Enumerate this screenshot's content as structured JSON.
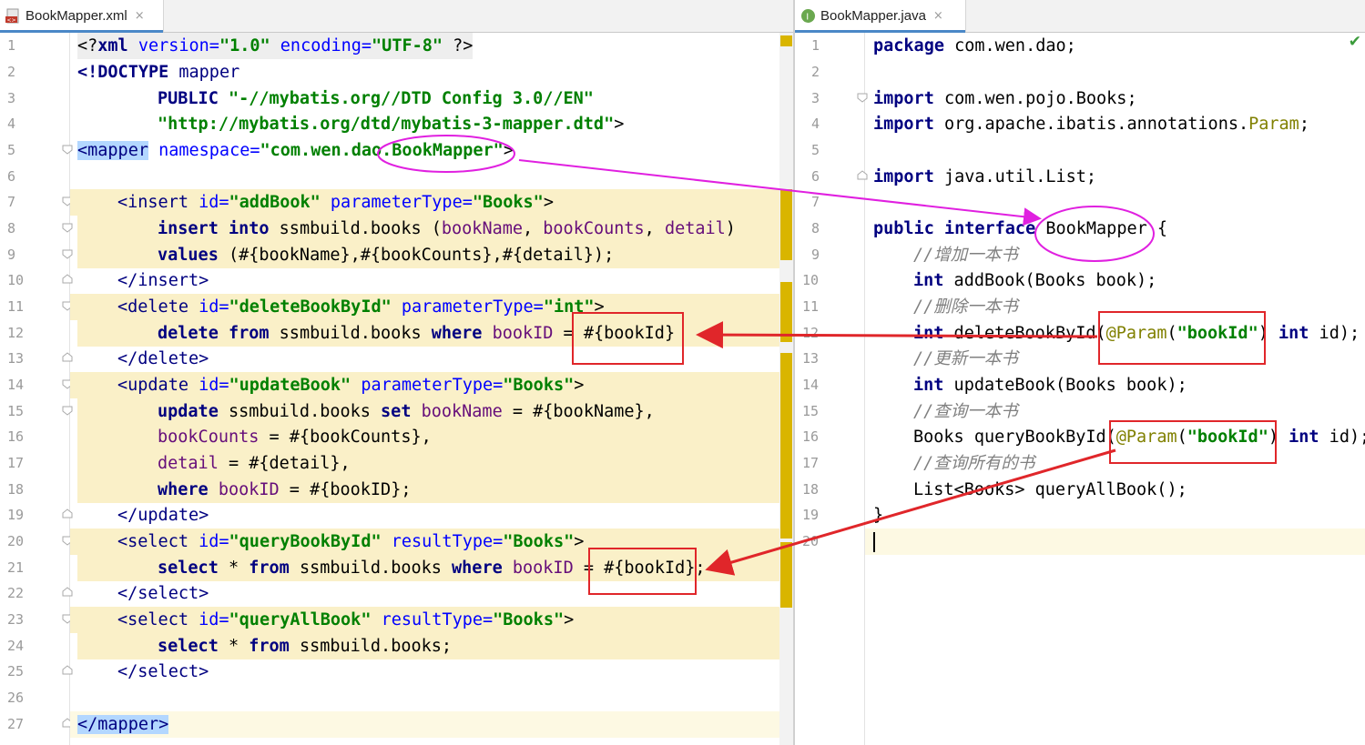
{
  "left_tab": {
    "name": "BookMapper.xml",
    "close": "×",
    "icon": "xml-file-icon"
  },
  "right_tab": {
    "name": "BookMapper.java",
    "close": "×",
    "icon": "java-interface-icon",
    "icon_letter": "I"
  },
  "left_lines": [
    "1",
    "2",
    "3",
    "4",
    "5",
    "6",
    "7",
    "8",
    "9",
    "10",
    "11",
    "12",
    "13",
    "14",
    "15",
    "16",
    "17",
    "18",
    "19",
    "20",
    "21",
    "22",
    "23",
    "24",
    "25",
    "26",
    "27"
  ],
  "right_lines": [
    "1",
    "2",
    "3",
    "4",
    "5",
    "6",
    "7",
    "8",
    "9",
    "10",
    "11",
    "12",
    "13",
    "14",
    "15",
    "16",
    "17",
    "18",
    "19",
    "20"
  ],
  "xml": {
    "l1_open": "<?",
    "l1_xml": "xml",
    "l1_version_attr": " version=",
    "l1_version_val": "\"1.0\"",
    "l1_enc_attr": " encoding=",
    "l1_enc_val": "\"UTF-8\"",
    "l1_close": " ?>",
    "l2_doctype": "<!DOCTYPE",
    "l2_mapper": " mapper",
    "l3_public": "PUBLIC",
    "l3_value": " \"-//mybatis.org//DTD Config 3.0//EN\"",
    "l4_value": "\"http://mybatis.org/dtd/mybatis-3-mapper.dtd\"",
    "l4_close": ">",
    "l5_tag": "<mapper",
    "l5_attr": " namespace=",
    "l5_val": "\"com.wen.dao.BookMapper\"",
    "l5_close": ">",
    "l7_tag": "<insert",
    "l7_id_attr": " id=",
    "l7_id_val": "\"addBook\"",
    "l7_pt_attr": " parameterType=",
    "l7_pt_val": "\"Books\"",
    "l7_close": ">",
    "l8_insert": "insert",
    "l8_into": " into",
    "l8_table": " ssmbuild.books (",
    "l8_c1": "bookName",
    "l8_sep1": ", ",
    "l8_c2": "bookCounts",
    "l8_sep2": ", ",
    "l8_c3": "detail",
    "l8_end": ")",
    "l9_values": "values",
    "l9_rest": " (#{bookName},#{bookCounts},#{detail});",
    "l10": "</insert>",
    "l11_tag": "<delete",
    "l11_id_attr": " id=",
    "l11_id_val": "\"deleteBookById\"",
    "l11_pt_attr": " parameterType=",
    "l11_pt_val": "\"int\"",
    "l11_close": ">",
    "l12_delete": "delete",
    "l12_from": " from",
    "l12_table": " ssmbuild.books ",
    "l12_where": "where",
    "l12_space": " ",
    "l12_col": "bookID",
    "l12_eq": " = ",
    "l12_param": "#{bookId}",
    "l13": "</delete>",
    "l14_tag": "<update",
    "l14_id_attr": " id=",
    "l14_id_val": "\"updateBook\"",
    "l14_pt_attr": " parameterType=",
    "l14_pt_val": "\"Books\"",
    "l14_close": ">",
    "l15_update": "update",
    "l15_table": " ssmbuild.books ",
    "l15_set": "set",
    "l15_space": " ",
    "l15_col": "bookName",
    "l15_rest": " = #{bookName},",
    "l16_col": "bookCounts",
    "l16_rest": " = #{bookCounts},",
    "l17_col": "detail",
    "l17_rest": " = #{detail},",
    "l18_where": "where",
    "l18_space": " ",
    "l18_col": "bookID",
    "l18_rest": " = #{bookID};",
    "l19": "</update>",
    "l20_tag": "<select",
    "l20_id_attr": " id=",
    "l20_id_val": "\"queryBookById\"",
    "l20_rt_attr": " resultType=",
    "l20_rt_val": "\"Books\"",
    "l20_close": ">",
    "l21_select": "select",
    "l21_star": " * ",
    "l21_from": "from",
    "l21_table": " ssmbuild.books ",
    "l21_where": "where",
    "l21_space": " ",
    "l21_col": "bookID",
    "l21_eq": " = ",
    "l21_param": "#{bookId};",
    "l22": "</select>",
    "l23_tag": "<select",
    "l23_id_attr": " id=",
    "l23_id_val": "\"queryAllBook\"",
    "l23_rt_attr": " resultType=",
    "l23_rt_val": "\"Books\"",
    "l23_close": ">",
    "l24_select": "select",
    "l24_star": " * ",
    "l24_from": "from",
    "l24_table": " ssmbuild.books;",
    "l25": "</select>",
    "l27": "</mapper>"
  },
  "java": {
    "l1_kw": "package",
    "l1_rest": " com.wen.dao;",
    "l3_kw": "import",
    "l3_rest": " com.wen.pojo.Books;",
    "l4_kw": "import",
    "l4_rest": " org.apache.ibatis.annotations.",
    "l4_param": "Param",
    "l4_end": ";",
    "l6_kw": "import",
    "l6_rest": " java.util.List;",
    "l8_kw": "public interface",
    "l8_name": " BookMapper ",
    "l8_brace": "{",
    "l9_comment": "//增加一本书",
    "l10_kw": "int",
    "l10_rest": " addBook(Books book);",
    "l11_comment": "//删除一本书",
    "l12_kw": "int",
    "l12_rest": " deleteBookById(",
    "l12_anno": "@Param",
    "l12_paren": "(",
    "l12_str": "\"bookId\"",
    "l12_close": ") ",
    "l12_kw2": "int",
    "l12_end": " id);",
    "l13_comment": "//更新一本书",
    "l14_kw": "int",
    "l14_rest": " updateBook(Books book);",
    "l15_comment": "//查询一本书",
    "l16_rest": "Books queryBookById(",
    "l16_anno": "@Param",
    "l16_paren": "(",
    "l16_str": "\"bookId\"",
    "l16_close": ") ",
    "l16_kw2": "int",
    "l16_end": " id);",
    "l17_comment": "//查询所有的书",
    "l18_rest": "List<Books> queryAllBook();",
    "l19": "}"
  },
  "colors": {
    "keyword": "#000080",
    "attribute": "#0000ff",
    "string": "#008000",
    "sql_column": "#660e7a",
    "comment": "#808080",
    "annotation": "#808000",
    "highlight_band": "#faf0c8",
    "annotation_red": "#e0262a",
    "annotation_magenta": "#e020e0"
  }
}
